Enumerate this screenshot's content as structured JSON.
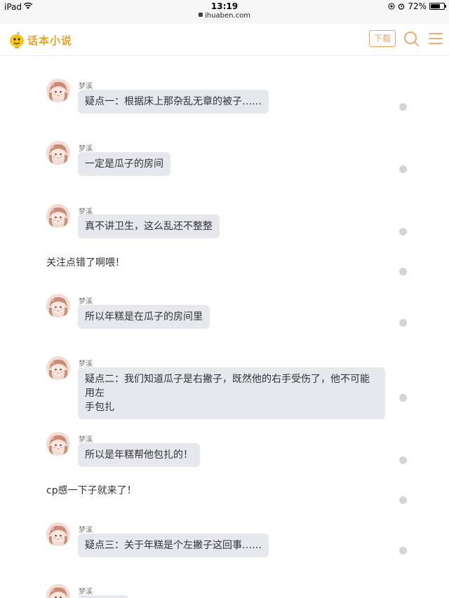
{
  "status_bar": {
    "device": "iPad",
    "time": "13:19",
    "url": "ihuaben.com",
    "battery": "72%",
    "battery_level": 0.72
  },
  "header": {
    "logo_text": "话本小说",
    "download_label": "下载",
    "icons": [
      "search-icon",
      "menu-icon"
    ]
  },
  "messages": [
    {
      "type": "dialogue",
      "sender": "梦溪",
      "text": "疑点一：根据床上那杂乱无章的被子……"
    },
    {
      "type": "dialogue",
      "sender": "梦溪",
      "text": "一定是瓜子的房间"
    },
    {
      "type": "dialogue",
      "sender": "梦溪",
      "text": "真不讲卫生，这么乱还不整整"
    },
    {
      "type": "narration",
      "text": "关注点错了啊喂！"
    },
    {
      "type": "dialogue",
      "sender": "梦溪",
      "text": "所以年糕是在瓜子的房间里"
    },
    {
      "type": "dialogue",
      "sender": "梦溪",
      "text_line1": "疑点二：我们知道瓜子是右撇子，既然他的右手受伤了，他不可能用左",
      "text_line2": "手包扎"
    },
    {
      "type": "dialogue",
      "sender": "梦溪",
      "text": "所以是年糕帮他包扎的！"
    },
    {
      "type": "narration",
      "text": "cp感一下子就来了！"
    },
    {
      "type": "dialogue",
      "sender": "梦溪",
      "text": "疑点三：关于年糕是个左撇子这回事……"
    },
    {
      "type": "dialogue",
      "sender": "梦溪",
      "text": ""
    }
  ],
  "colors": {
    "accent": "#e8a262",
    "bubble": "#e6e8ee",
    "logo": "#f0a020"
  }
}
